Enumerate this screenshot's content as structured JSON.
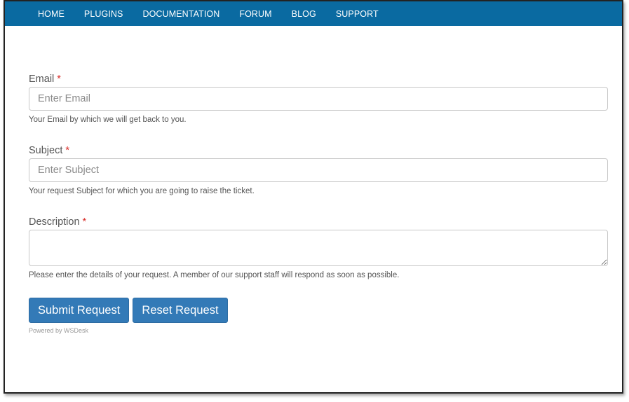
{
  "nav": {
    "items": [
      "HOME",
      "PLUGINS",
      "DOCUMENTATION",
      "FORUM",
      "BLOG",
      "SUPPORT"
    ]
  },
  "form": {
    "email": {
      "label": "Email",
      "required_mark": "*",
      "placeholder": "Enter Email",
      "value": "",
      "help": "Your Email by which we will get back to you."
    },
    "subject": {
      "label": "Subject",
      "required_mark": "*",
      "placeholder": "Enter Subject",
      "value": "",
      "help": "Your request Subject for which you are going to raise the ticket."
    },
    "description": {
      "label": "Description",
      "required_mark": "*",
      "value": "",
      "help": "Please enter the details of your request. A member of our support staff will respond as soon as possible."
    },
    "submit_label": "Submit Request",
    "reset_label": "Reset Request",
    "powered_by": "Powered by WSDesk"
  },
  "colors": {
    "nav_bg": "#0a6aa1",
    "button_bg": "#337ab7",
    "required": "#d9302c"
  }
}
